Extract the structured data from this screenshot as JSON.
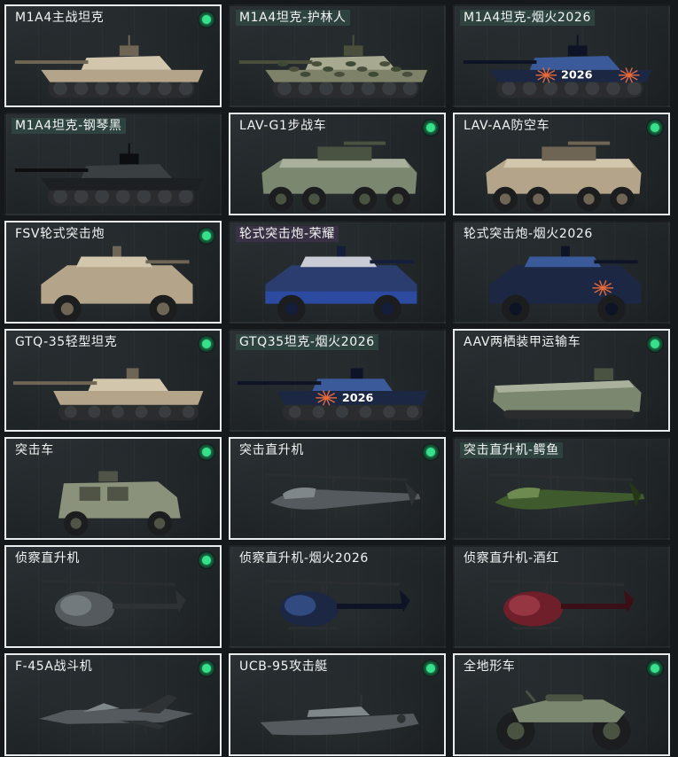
{
  "palette": {
    "selected_border": "#e9ecec",
    "available_dot": "#37e08a",
    "card_background": "#23282b",
    "label_tint": "#304842"
  },
  "vehicles": [
    {
      "label": "M1A4主战坦克",
      "kind": "tank",
      "icon": "main-battle-tank-icon",
      "camo": "desert",
      "selected": true,
      "available": true,
      "label_tint": false
    },
    {
      "label": "M1A4坦克-护林人",
      "kind": "tank",
      "icon": "main-battle-tank-icon",
      "camo": "woodland",
      "selected": false,
      "available": false,
      "label_tint": true
    },
    {
      "label": "M1A4坦克-烟火2026",
      "kind": "tank",
      "icon": "main-battle-tank-icon",
      "camo": "firework",
      "badge": "2026",
      "selected": false,
      "available": false,
      "label_tint": true
    },
    {
      "label": "M1A4坦克-钢琴黑",
      "kind": "tank-dark",
      "icon": "main-battle-tank-icon",
      "camo": "black",
      "selected": false,
      "available": false,
      "label_tint": true
    },
    {
      "label": "LAV-G1步战车",
      "kind": "apc",
      "icon": "wheeled-ifv-icon",
      "camo": "green",
      "selected": true,
      "available": true,
      "label_tint": false
    },
    {
      "label": "LAV-AA防空车",
      "kind": "apc",
      "icon": "anti-air-vehicle-icon",
      "camo": "desert",
      "selected": true,
      "available": true,
      "label_tint": false
    },
    {
      "label": "FSV轮式突击炮",
      "kind": "assault",
      "icon": "wheeled-assault-gun-icon",
      "camo": "desert",
      "selected": true,
      "available": true,
      "label_tint": false
    },
    {
      "label": "轮式突击炮-荣耀",
      "kind": "assault",
      "icon": "wheeled-assault-gun-icon",
      "camo": "glory",
      "selected": false,
      "available": false,
      "label_tint": true,
      "tint_style": "violet"
    },
    {
      "label": "轮式突击炮-烟火2026",
      "kind": "assault",
      "icon": "wheeled-assault-gun-icon",
      "camo": "firework",
      "selected": false,
      "available": false,
      "label_tint": false
    },
    {
      "label": "GTQ-35轻型坦克",
      "kind": "lighttank",
      "icon": "light-tank-icon",
      "camo": "desert",
      "selected": true,
      "available": true,
      "label_tint": false
    },
    {
      "label": "GTQ35坦克-烟火2026",
      "kind": "lighttank",
      "icon": "light-tank-icon",
      "camo": "firework",
      "badge": "2026",
      "selected": false,
      "available": false,
      "label_tint": true
    },
    {
      "label": "AAV两栖装甲运输车",
      "kind": "aav",
      "icon": "amphibious-carrier-icon",
      "camo": "green",
      "selected": true,
      "available": true,
      "label_tint": false
    },
    {
      "label": "突击车",
      "kind": "mrap",
      "icon": "assault-vehicle-icon",
      "camo": "sage",
      "selected": true,
      "available": true,
      "label_tint": false
    },
    {
      "label": "突击直升机",
      "kind": "heli-attack",
      "icon": "attack-helicopter-icon",
      "camo": "grey",
      "selected": true,
      "available": true,
      "label_tint": false
    },
    {
      "label": "突击直升机-鳄鱼",
      "kind": "heli-attack",
      "icon": "attack-helicopter-icon",
      "camo": "croc",
      "selected": false,
      "available": false,
      "label_tint": true
    },
    {
      "label": "侦察直升机",
      "kind": "heli-scout",
      "icon": "scout-helicopter-icon",
      "camo": "grey",
      "selected": true,
      "available": true,
      "label_tint": false
    },
    {
      "label": "侦察直升机-烟火2026",
      "kind": "heli-scout",
      "icon": "scout-helicopter-icon",
      "camo": "firework",
      "selected": false,
      "available": false,
      "label_tint": false
    },
    {
      "label": "侦察直升机-酒红",
      "kind": "heli-scout",
      "icon": "scout-helicopter-icon",
      "camo": "wine",
      "selected": false,
      "available": false,
      "label_tint": false
    },
    {
      "label": "F-45A战斗机",
      "kind": "jet",
      "icon": "fighter-jet-icon",
      "camo": "grey",
      "selected": true,
      "available": true,
      "label_tint": false
    },
    {
      "label": "UCB-95攻击艇",
      "kind": "boat",
      "icon": "attack-boat-icon",
      "camo": "grey",
      "selected": true,
      "available": true,
      "label_tint": false
    },
    {
      "label": "全地形车",
      "kind": "atv",
      "icon": "atv-icon",
      "camo": "green",
      "selected": true,
      "available": true,
      "label_tint": false
    }
  ]
}
